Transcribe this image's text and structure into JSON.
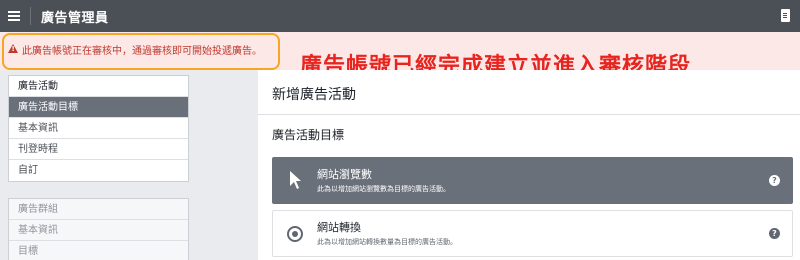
{
  "app": {
    "title": "廣告管理員"
  },
  "alert": {
    "message": "此廣告帳號正在審核中，通過審核即可開始投遞廣告。"
  },
  "annotation": {
    "text": "廣告帳號已經完成建立並進入審核階段"
  },
  "sidebar": {
    "campaign": {
      "header": "廣告活動",
      "items": [
        "廣告活動目標",
        "基本資訊",
        "刊登時程",
        "自訂"
      ]
    },
    "adset": {
      "header": "廣告群組",
      "items": [
        "基本資訊",
        "目標"
      ]
    }
  },
  "main": {
    "title": "新增廣告活動",
    "section_title": "廣告活動目標",
    "options": [
      {
        "title": "網站瀏覽數",
        "desc": "此為以增加網站瀏覽數為目標的廣告活動。",
        "icon": "cursor-icon"
      },
      {
        "title": "網站轉換",
        "desc": "此為以增加網站轉換數量為目標的廣告活動。",
        "icon": "target-icon"
      }
    ]
  },
  "colors": {
    "topbar": "#4b4f56",
    "alert_bg": "#fde8e8",
    "alert_text": "#be3a2b",
    "annotation": "#e8241f",
    "selected": "#6a707a",
    "highlight_outline": "#f5a623"
  }
}
